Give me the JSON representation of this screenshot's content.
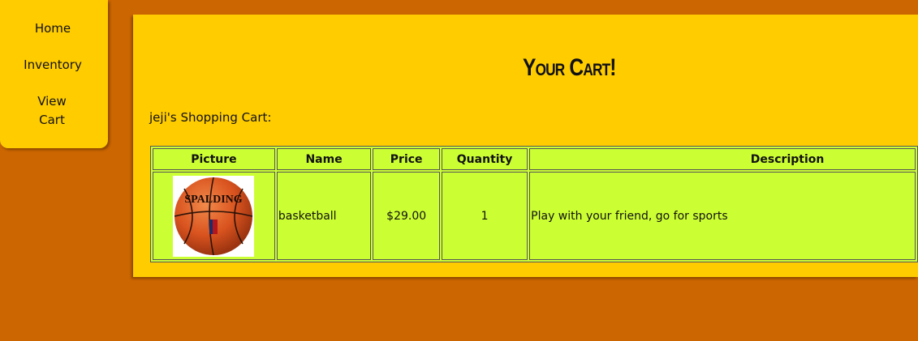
{
  "nav": {
    "home": "Home",
    "inventory": "Inventory",
    "view_cart_line1": "View",
    "view_cart_line2": "Cart"
  },
  "page": {
    "title": "Your Cart!",
    "owner_label": "jeji's Shopping Cart:"
  },
  "cart": {
    "columns": [
      "Picture",
      "Name",
      "Price",
      "Quantity",
      "Description"
    ],
    "rows": [
      {
        "picture_icon": "basketball-image",
        "picture_brand": "SPALDING",
        "name": "basketball",
        "price": "$29.00",
        "quantity": "1",
        "description": "Play with your friend, go for sports"
      }
    ]
  },
  "colors": {
    "background": "#cc6600",
    "panel": "#ffcc00",
    "table": "#ccff33",
    "ball": "#e2622a"
  }
}
